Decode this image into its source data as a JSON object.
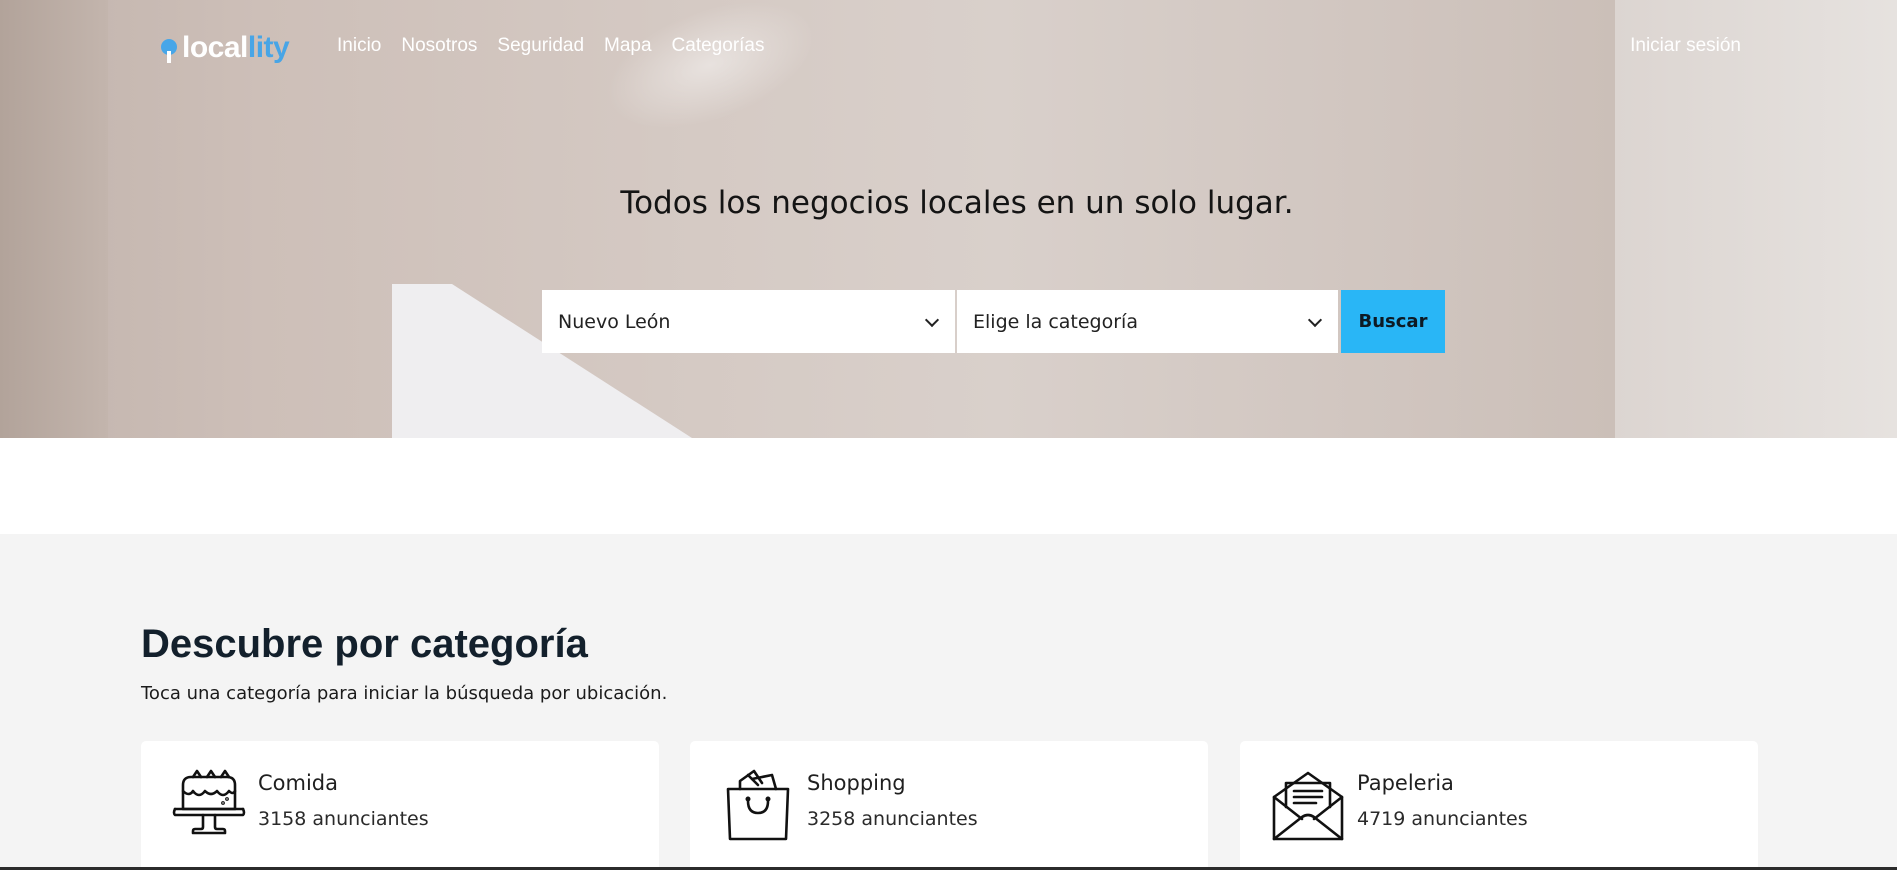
{
  "brand": {
    "name_part1": "local",
    "name_part2": "lity",
    "pin_color": "#47a6e8",
    "accent": "#48a5e6"
  },
  "nav": {
    "items": [
      {
        "label": "Inicio"
      },
      {
        "label": "Nosotros"
      },
      {
        "label": "Seguridad"
      },
      {
        "label": "Mapa"
      },
      {
        "label": "Categorías"
      }
    ],
    "login_label": "Iniciar sesión"
  },
  "hero": {
    "title": "Todos los negocios locales en un solo lugar.",
    "location_value": "Nuevo León",
    "category_placeholder": "Elige la categoría",
    "search_button": "Buscar",
    "button_color": "#29b6f6"
  },
  "categories": {
    "title": "Descubre por categoría",
    "subtitle": "Toca una categoría para iniciar la búsqueda por ubicación.",
    "items": [
      {
        "name": "Comida",
        "count": "3158 anunciantes",
        "icon": "cake-icon"
      },
      {
        "name": "Shopping",
        "count": "3258 anunciantes",
        "icon": "shopping-bag-icon"
      },
      {
        "name": "Papeleria",
        "count": "4719 anunciantes",
        "icon": "envelope-icon"
      }
    ]
  }
}
